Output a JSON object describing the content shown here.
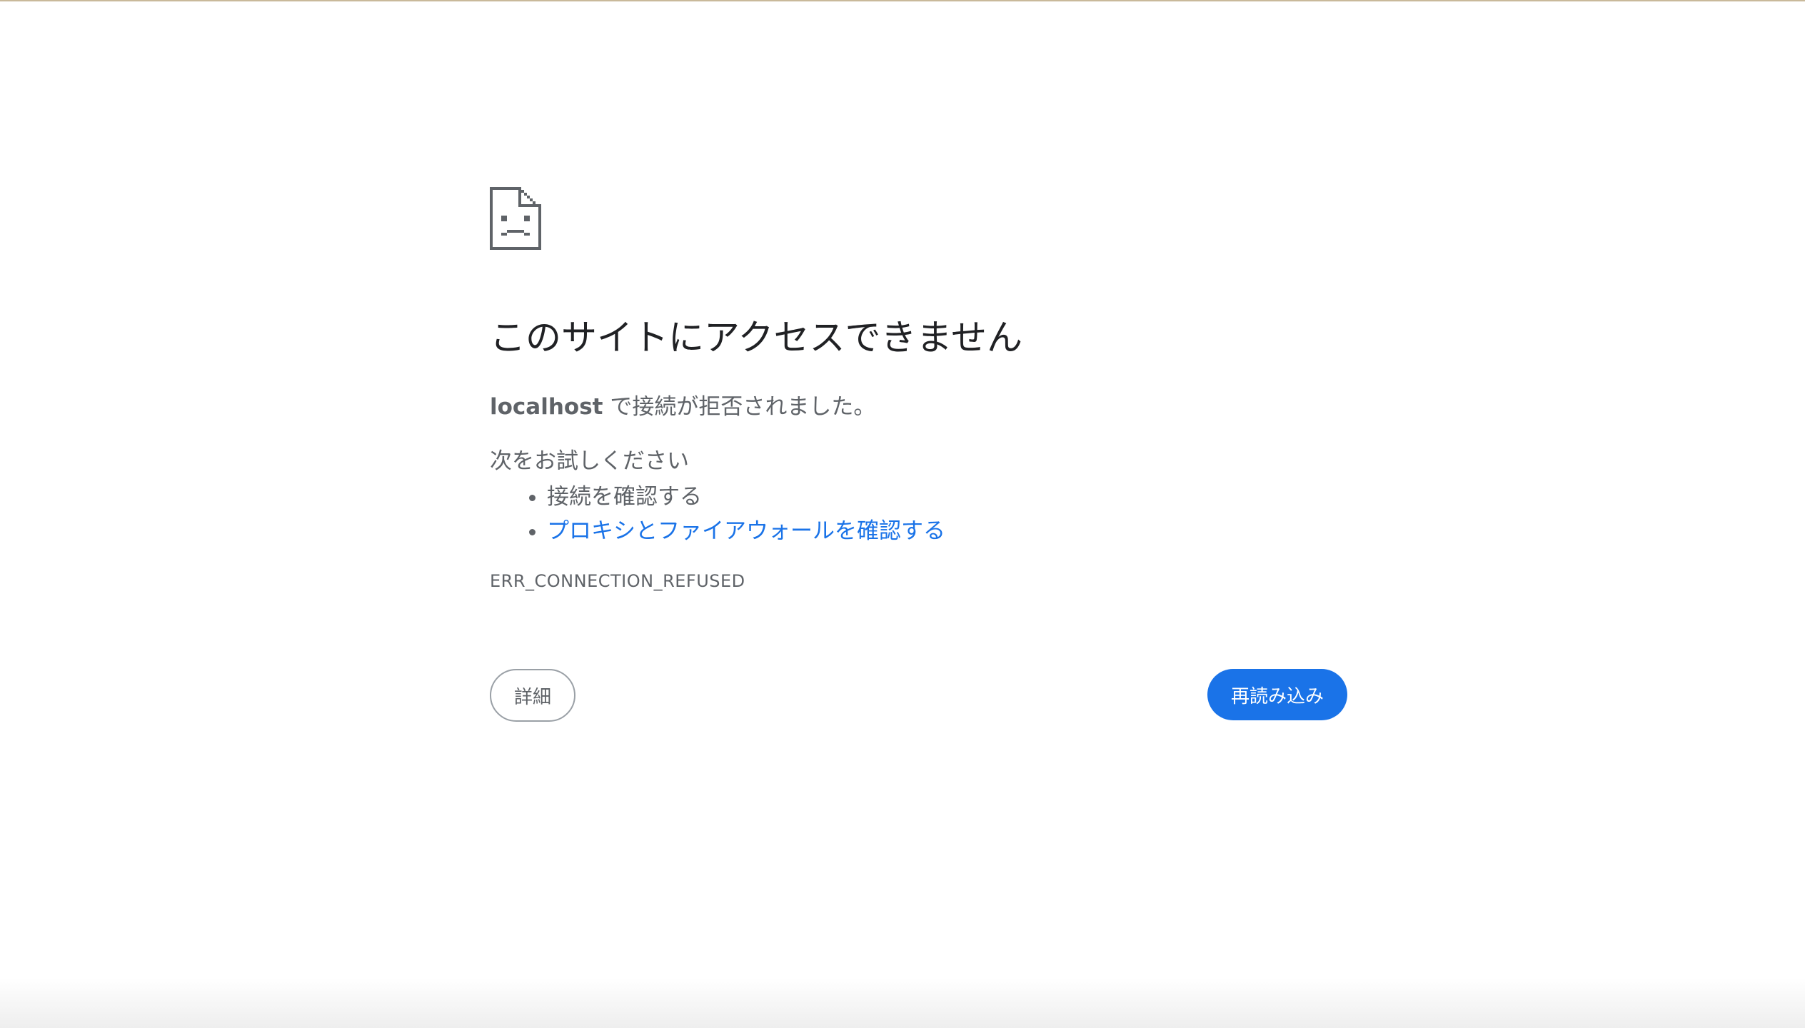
{
  "error_page": {
    "icon": "sad-document-icon",
    "headline": "このサイトにアクセスできません",
    "host": "localhost",
    "host_message": " で接続が拒否されました。",
    "suggestions_title": "次をお試しください",
    "suggestions": [
      "接続を確認する",
      "プロキシとファイアウォールを確認する"
    ],
    "error_code": "ERR_CONNECTION_REFUSED",
    "details_label": "詳細",
    "reload_label": "再読み込み"
  },
  "colors": {
    "link": "#1a73e8",
    "primary_button": "#1a73e8",
    "text": "#5f6368",
    "headline": "#202124"
  }
}
